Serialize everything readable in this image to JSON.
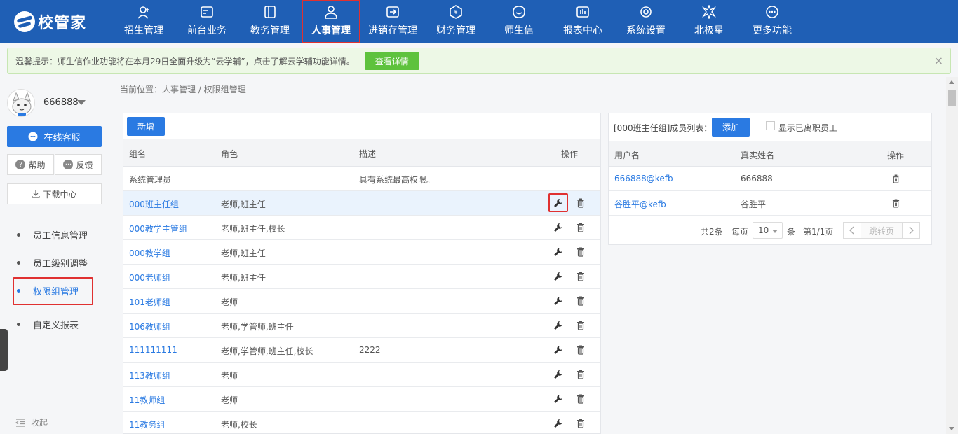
{
  "app": {
    "logo_text": "校管家"
  },
  "nav": {
    "items": [
      {
        "label": "招生管理",
        "icon": "user-plus-icon"
      },
      {
        "label": "前台业务",
        "icon": "id-card-icon"
      },
      {
        "label": "教务管理",
        "icon": "book-icon"
      },
      {
        "label": "人事管理",
        "icon": "person-icon"
      },
      {
        "label": "进销存管理",
        "icon": "arrow-box-icon"
      },
      {
        "label": "财务管理",
        "icon": "yen-icon"
      },
      {
        "label": "师生信",
        "icon": "chat-icon"
      },
      {
        "label": "报表中心",
        "icon": "chart-icon"
      },
      {
        "label": "系统设置",
        "icon": "gear-icon"
      },
      {
        "label": "北极星",
        "icon": "star-icon"
      },
      {
        "label": "更多功能",
        "icon": "more-icon"
      }
    ],
    "active_index": 3
  },
  "notice": {
    "text": "温馨提示：师生信作业功能将在本月29日全面升级为“云学辅”，点击了解云学辅功能详情。",
    "button": "查看详情",
    "close": "×"
  },
  "sidebar": {
    "username": "666888",
    "service_button": "在线客服",
    "help": "帮助",
    "feedback": "反馈",
    "download": "下载中心",
    "menu": [
      {
        "label": "员工信息管理"
      },
      {
        "label": "员工级别调整"
      },
      {
        "label": "权限组管理"
      },
      {
        "label": "自定义报表"
      }
    ],
    "collapse": "收起"
  },
  "breadcrumb": "当前位置：人事管理 / 权限组管理",
  "groups": {
    "add_button": "新增",
    "columns": [
      "组名",
      "角色",
      "描述",
      "操作"
    ],
    "rows": [
      {
        "name": "系统管理员",
        "roles": "",
        "desc": "具有系统最高权限。",
        "link": false,
        "ops": false
      },
      {
        "name": "000班主任组",
        "roles": "老师,班主任",
        "desc": "",
        "link": true,
        "ops": true
      },
      {
        "name": "000教学主管组",
        "roles": "老师,班主任,校长",
        "desc": "",
        "link": true,
        "ops": true
      },
      {
        "name": "000教学组",
        "roles": "老师,班主任",
        "desc": "",
        "link": true,
        "ops": true
      },
      {
        "name": "000老师组",
        "roles": "老师,班主任",
        "desc": "",
        "link": true,
        "ops": true
      },
      {
        "name": "101老师组",
        "roles": "老师",
        "desc": "",
        "link": true,
        "ops": true
      },
      {
        "name": "106教师组",
        "roles": "老师,学管师,班主任",
        "desc": "",
        "link": true,
        "ops": true
      },
      {
        "name": "111111111",
        "roles": "老师,学管师,班主任,校长",
        "desc": "2222",
        "link": true,
        "ops": true
      },
      {
        "name": "113教师组",
        "roles": "老师",
        "desc": "",
        "link": true,
        "ops": true
      },
      {
        "name": "11教师组",
        "roles": "老师",
        "desc": "",
        "link": true,
        "ops": true
      },
      {
        "name": "11教务组",
        "roles": "老师,校长",
        "desc": "",
        "link": true,
        "ops": true
      }
    ]
  },
  "members": {
    "title": "[000班主任组]成员列表：",
    "add_button": "添加",
    "show_resigned_label": "显示已离职员工",
    "columns": [
      "用户名",
      "真实姓名",
      "操作"
    ],
    "rows": [
      {
        "username": "666888@kefb",
        "realname": "666888"
      },
      {
        "username": "谷胜平@kefb",
        "realname": "谷胜平"
      }
    ],
    "pager": {
      "total": "共2条",
      "per_page_label": "每页",
      "per_page_value": "10",
      "unit": "条",
      "page_info": "第1/1页",
      "jump": "跳转页"
    }
  },
  "colors": {
    "brand": "#1f5fb5",
    "accent": "#2a7ae2",
    "highlight": "#e03131",
    "success": "#5ec23d"
  }
}
